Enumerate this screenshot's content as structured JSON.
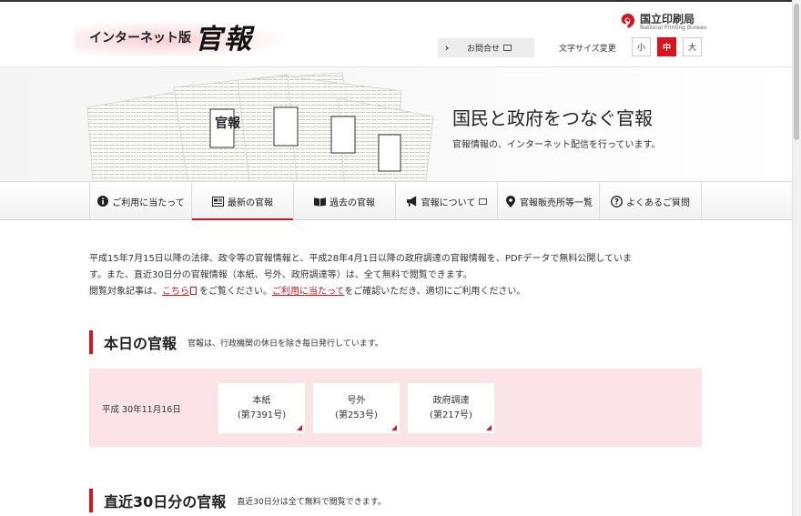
{
  "header": {
    "logo_sub": "インターネット版",
    "logo_main": "官報",
    "bureau_name": "国立印刷局",
    "bureau_en": "National Printing Bureau",
    "contact_label": "お問合せ",
    "font_size_label": "文字サイズ変更",
    "font_sizes": [
      "小",
      "中",
      "大"
    ],
    "font_size_selected": "中"
  },
  "hero": {
    "title": "国民と政府をつなぐ官報",
    "subtitle": "官報情報の、インターネット配信を行っています。",
    "newspaper_masthead": "官報"
  },
  "nav": {
    "items": [
      {
        "label": "ご利用に当たって",
        "icon": "info-icon"
      },
      {
        "label": "最新の官報",
        "icon": "newspaper-icon"
      },
      {
        "label": "過去の官報",
        "icon": "book-icon"
      },
      {
        "label": "官報について",
        "icon": "megaphone-icon"
      },
      {
        "label": "官報販売所等一覧",
        "icon": "map-pin-icon"
      },
      {
        "label": "よくあるご質問",
        "icon": "question-icon"
      }
    ],
    "selected": "最新の官報"
  },
  "intro": {
    "line1": "平成15年7月15日以降の法律、政令等の官報情報と、平成28年4月1日以降の政府調達の官報情報を、PDFデータで無料公開していま",
    "line2": "す。また、直近30日分の官報情報（本紙、号外、政府調達等）は、全て無料で閲覧できます。",
    "line3_a": "閲覧対象記事は、",
    "link_here": "こちら",
    "line3_b": "をご覧ください。",
    "link_usage": "ご利用に当たって",
    "line3_c": "をご確認いただき、適切にご利用ください。"
  },
  "today": {
    "title": "本日の官報",
    "note": "官報は、行政機関の休日を除き毎日発行しています。",
    "date": "平成 30年11月16日",
    "issues": [
      {
        "name": "本紙",
        "number": "(第7391号)"
      },
      {
        "name": "号外",
        "number": "(第253号)"
      },
      {
        "name": "政府調達",
        "number": "(第217号)"
      }
    ]
  },
  "recent": {
    "title": "直近30日分の官報",
    "note": "直近30日分は全て無料で閲覧できます。"
  },
  "colors": {
    "accent": "#d9141e",
    "today_bg": "#fbe3e7"
  }
}
